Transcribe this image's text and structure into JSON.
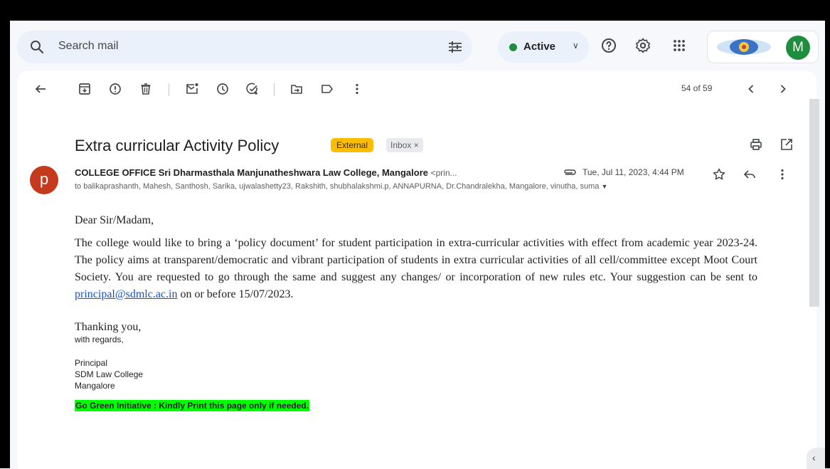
{
  "header": {
    "search_placeholder": "Search mail",
    "status_label": "Active",
    "avatar_letter": "M"
  },
  "toolbar": {
    "count": "54 of 59"
  },
  "email": {
    "subject": "Extra curricular Activity Policy",
    "label_external": "External",
    "label_inbox": "Inbox ×",
    "sender_avatar": "p",
    "sender_name": "COLLEGE OFFICE Sri Dharmasthala Manjunatheshwara Law College, Mangalore",
    "sender_address": "<prin...",
    "date": "Tue, Jul 11, 2023, 4:44 PM",
    "recipients": "to balikaprashanth, Mahesh, Santhosh, Sarika, ujwalashetty23, Rakshith, shubhalakshmi.p, ANNAPURNA, Dr.Chandralekha, Mangalore, vinutha, suma",
    "greeting": "Dear Sir/Madam,",
    "para_text": "The college would like to bring a ‘policy document’ for student participation in extra-curricular activities with effect from academic year 2023-24.  The policy aims at transparent/democratic and vibrant participation of students in extra curricular activities of all cell/committee except Moot Court Society.  You are requested to go through the same and suggest any changes/ or incorporation of new rules etc.  Your suggestion can be sent to",
    "link": "principal@sdmlc.ac.in",
    "para_end": "on or before 15/07/2023.",
    "thanks": "Thanking you,",
    "regards": "with regards,",
    "sig_1": "Principal",
    "sig_2": "SDM Law College",
    "sig_3": "Mangalore",
    "green_note": "Go Green Initiative : Kindly Print this page only if needed."
  },
  "colors": {
    "accent": "#0b57d0",
    "external_badge": "#fbbc04",
    "sender_avatar_bg": "#c5391c",
    "account_avatar_bg": "#1e8e3e",
    "green_note_bg": "#00ff00"
  },
  "icons": [
    "search-icon",
    "filter-icon",
    "help-icon",
    "settings-icon",
    "apps-icon",
    "back-arrow-icon",
    "archive-icon",
    "report-spam-icon",
    "delete-icon",
    "mark-unread-icon",
    "snooze-icon",
    "add-task-icon",
    "move-to-icon",
    "label-icon",
    "more-vert-icon",
    "chevron-left-icon",
    "chevron-right-icon",
    "print-icon",
    "open-new-window-icon",
    "attachment-icon",
    "star-icon",
    "reply-icon",
    "dropdown-arrow-icon"
  ]
}
